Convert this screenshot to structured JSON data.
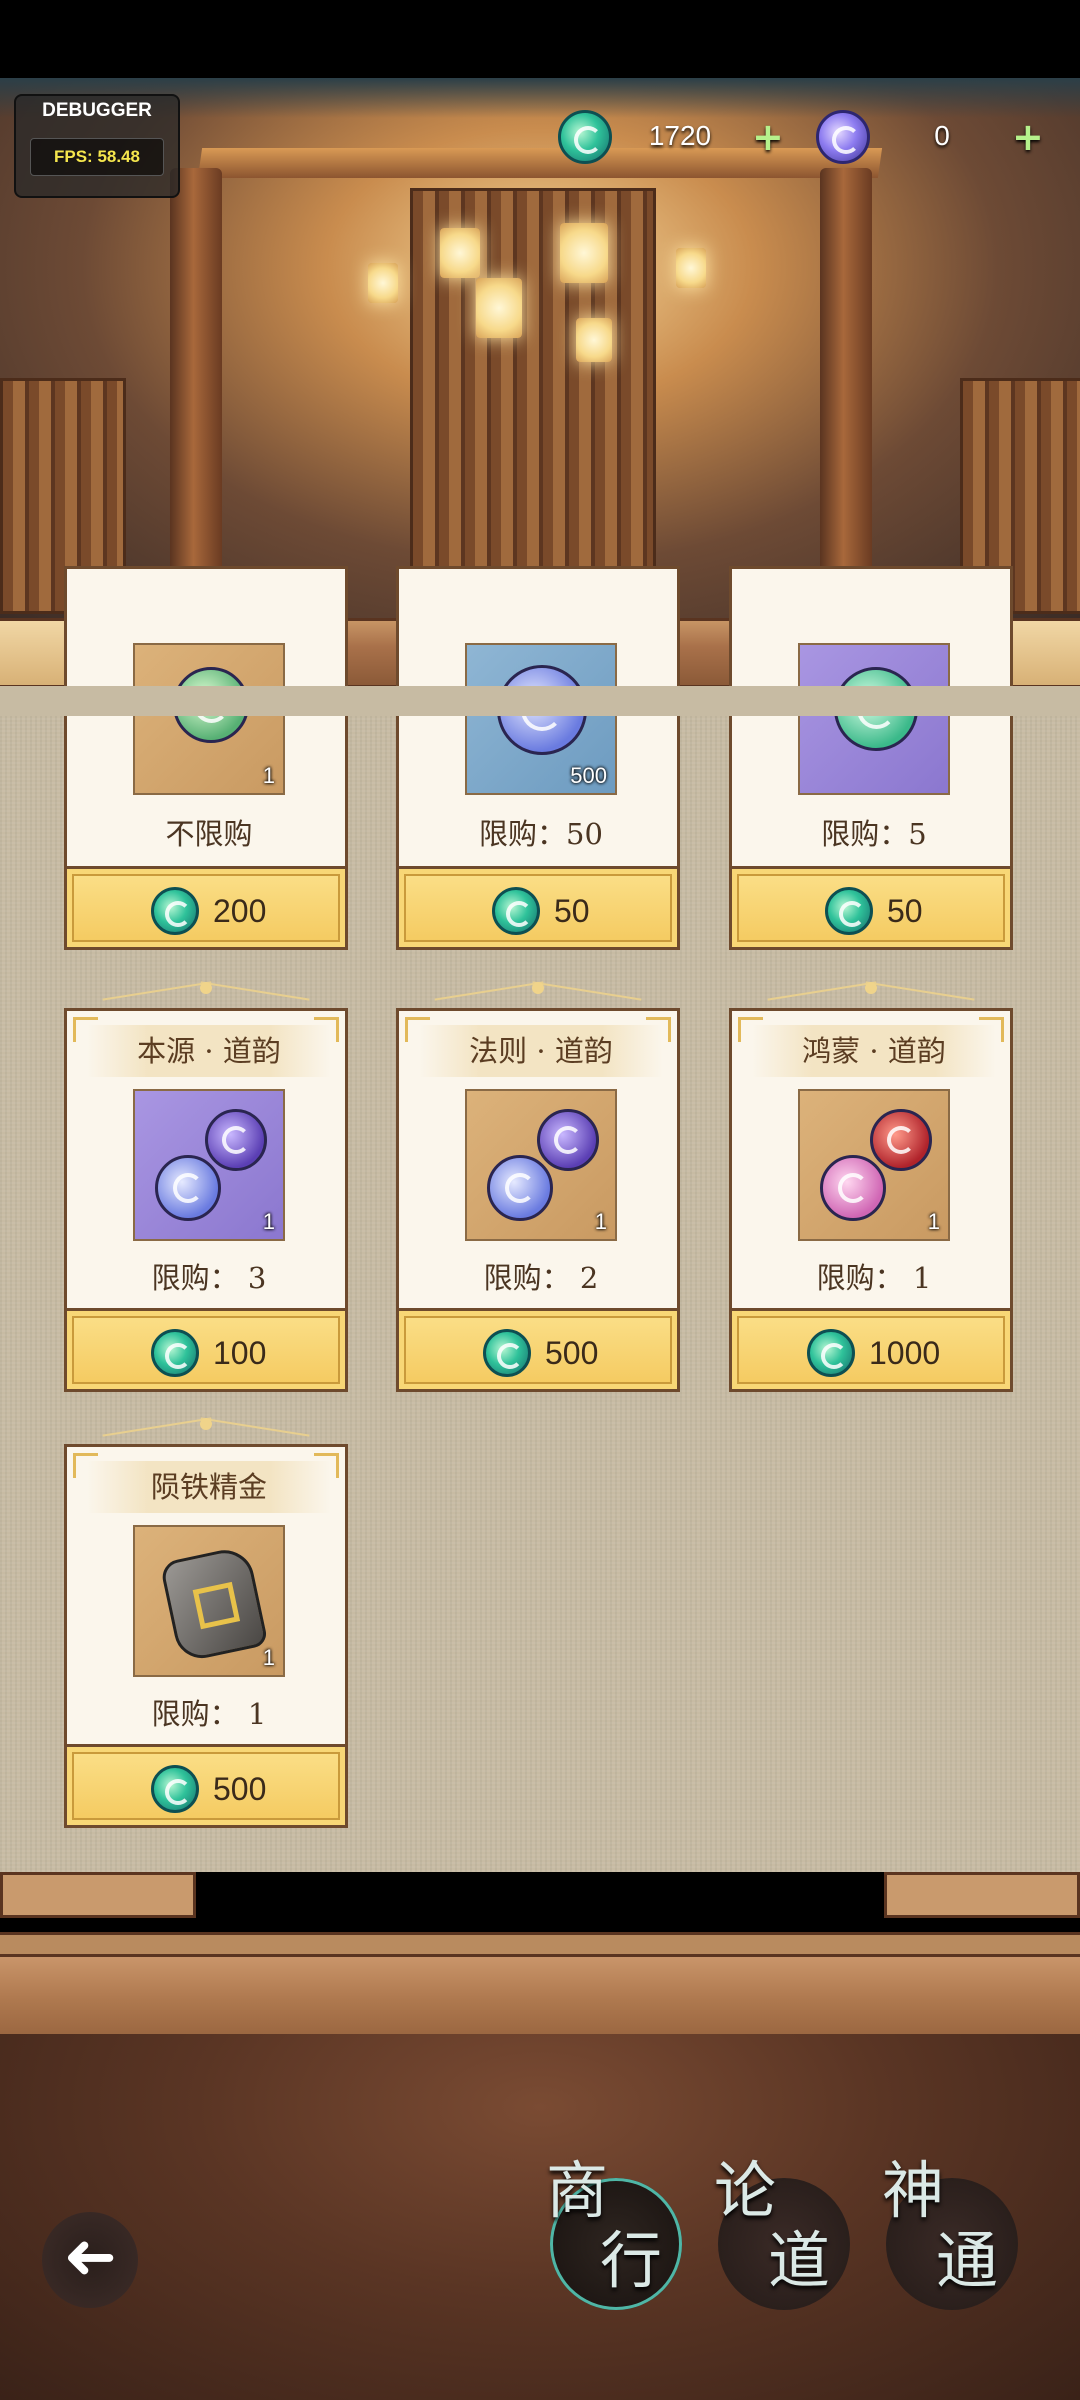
{
  "debugger": {
    "title": "DEBUGGER",
    "fps": "FPS: 58.48"
  },
  "currency": {
    "jade": {
      "icon": "jade-coin-icon",
      "value": "1720",
      "add": "+"
    },
    "orb": {
      "icon": "blue-orb-icon",
      "value": "0",
      "add": "+"
    }
  },
  "items": [
    {
      "title": "",
      "icon": "jade-dragon-icon",
      "qty": "1",
      "limit": "不限购",
      "price": "200",
      "box": "gold"
    },
    {
      "title": "",
      "icon": "blue-orb-icon",
      "qty": "500",
      "limit": "限购：50",
      "price": "50",
      "box": "blue"
    },
    {
      "title": "",
      "icon": "green-orb-icon",
      "qty": "",
      "limit": "限购：5",
      "price": "50",
      "box": "purple"
    },
    {
      "title": "本源 · 道韵",
      "icon": "blue-purple-orbs-icon",
      "qty": "1",
      "limit": "限购： 3",
      "price": "100",
      "box": "purple"
    },
    {
      "title": "法则 · 道韵",
      "icon": "blue-purple-orbs-icon",
      "qty": "1",
      "limit": "限购： 2",
      "price": "500",
      "box": "gold"
    },
    {
      "title": "鸿蒙 · 道韵",
      "icon": "pink-red-orbs-icon",
      "qty": "1",
      "limit": "限购： 1",
      "price": "1000",
      "box": "gold"
    },
    {
      "title": "陨铁精金",
      "icon": "meteor-iron-icon",
      "qty": "1",
      "limit": "限购： 1",
      "price": "500",
      "box": "gold"
    }
  ],
  "tabs": [
    {
      "chars": [
        "商",
        "行"
      ],
      "active": true
    },
    {
      "chars": [
        "论",
        "道"
      ],
      "active": false
    },
    {
      "chars": [
        "神",
        "通"
      ],
      "active": false
    }
  ],
  "back": {
    "icon": "back-arrow-icon",
    "glyph": "➜"
  }
}
